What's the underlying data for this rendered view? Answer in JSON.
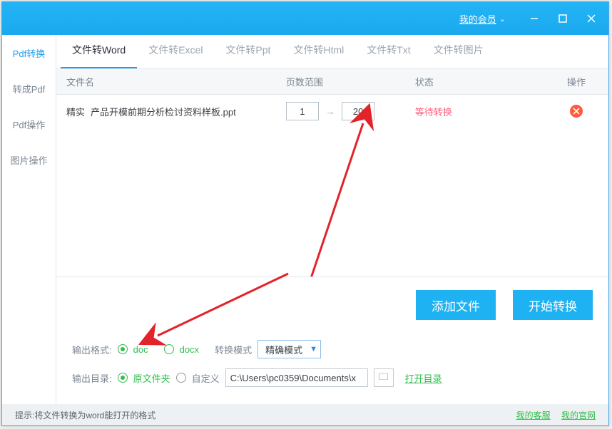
{
  "titlebar": {
    "member": "我的会员"
  },
  "sidebar": {
    "items": [
      {
        "label": "Pdf转换"
      },
      {
        "label": "转成Pdf"
      },
      {
        "label": "Pdf操作"
      },
      {
        "label": "图片操作"
      }
    ]
  },
  "tabs": [
    {
      "label": "文件转Word"
    },
    {
      "label": "文件转Excel"
    },
    {
      "label": "文件转Ppt"
    },
    {
      "label": "文件转Html"
    },
    {
      "label": "文件转Txt"
    },
    {
      "label": "文件转图片"
    }
  ],
  "listhead": {
    "name": "文件名",
    "pages": "页数范围",
    "status": "状态",
    "op": "操作"
  },
  "rows": [
    {
      "tag": "精实",
      "name": "产品开模前期分析检讨资料样板.ppt",
      "page_from": "1",
      "page_to": "20",
      "status": "等待转换"
    }
  ],
  "buttons": {
    "add": "添加文件",
    "start": "开始转换"
  },
  "output_format": {
    "label": "输出格式:",
    "doc": "doc",
    "docx": "docx",
    "mode_label": "转换模式",
    "mode_value": "精确模式"
  },
  "output_dir": {
    "label": "输出目录:",
    "original": "原文件夹",
    "custom_label": "自定义",
    "path": "C:\\Users\\pc0359\\Documents\\x",
    "open": "打开目录"
  },
  "hint": {
    "text": "提示:将文件转换为word能打开的格式",
    "service": "我的客服",
    "site": "我的官网"
  }
}
